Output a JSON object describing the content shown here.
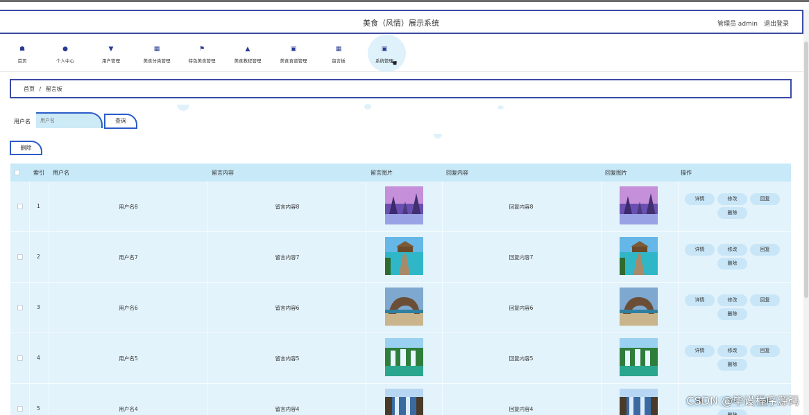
{
  "header": {
    "title": "美食（风情）展示系统",
    "user_label": "管理员 admin",
    "logout_label": "退出登录"
  },
  "nav": {
    "items": [
      {
        "label": "首页",
        "icon": "home-icon"
      },
      {
        "label": "个人中心",
        "icon": "user-icon"
      },
      {
        "label": "用户管理",
        "icon": "users-icon"
      },
      {
        "label": "美食分类管理",
        "icon": "grid-icon"
      },
      {
        "label": "特色美食管理",
        "icon": "flag-icon"
      },
      {
        "label": "美食教程管理",
        "icon": "person-icon"
      },
      {
        "label": "美食食谱管理",
        "icon": "clipboard-icon"
      },
      {
        "label": "留言板",
        "icon": "grid-icon"
      },
      {
        "label": "系统管理",
        "icon": "briefcase-icon"
      }
    ],
    "active_index": 8
  },
  "breadcrumb": {
    "home": "首页",
    "separator": "/",
    "current": "留言板"
  },
  "search": {
    "label": "用户名",
    "placeholder": "用户名",
    "button": "查询"
  },
  "toolbar": {
    "delete_label": "删除"
  },
  "table": {
    "headers": {
      "index": "索引",
      "username": "用户名",
      "content": "留言内容",
      "image": "留言图片",
      "reply": "回复内容",
      "reply_image": "回复图片",
      "actions": "操作"
    },
    "rows": [
      {
        "index": "1",
        "username": "用户名8",
        "content": "留言内容8",
        "reply": "回复内容8",
        "image_theme": "purple-winter-forest"
      },
      {
        "index": "2",
        "username": "用户名7",
        "content": "留言内容7",
        "reply": "回复内容7",
        "image_theme": "tropical-pier"
      },
      {
        "index": "3",
        "username": "用户名6",
        "content": "留言内容6",
        "reply": "回复内容6",
        "image_theme": "rock-arch-beach"
      },
      {
        "index": "4",
        "username": "用户名5",
        "content": "留言内容5",
        "reply": "回复内容5",
        "image_theme": "green-waterfall"
      },
      {
        "index": "5",
        "username": "用户名4",
        "content": "留言内容4",
        "reply": "回复内容4",
        "image_theme": "blue-waterfall"
      }
    ],
    "row_actions": {
      "detail": "详情",
      "edit": "修改",
      "reply": "回复",
      "delete": "删除"
    }
  },
  "watermark": "CSDN @毕设程序源码",
  "colors": {
    "accent_border": "#3a4aa6",
    "button_border": "#2a5cc8",
    "header_row": "#c8e9f8",
    "body_row": "#e3f3fb",
    "action_button": "#c8e6f7",
    "icon": "#2a3b8f"
  }
}
